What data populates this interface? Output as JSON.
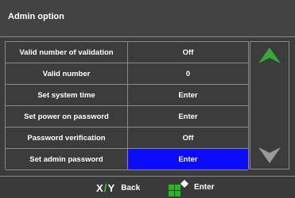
{
  "header": {
    "title": "Admin option"
  },
  "rows": [
    {
      "label": "Valid number of validation",
      "value": "Off"
    },
    {
      "label": "Valid number",
      "value": "0"
    },
    {
      "label": "Set system time",
      "value": "Enter"
    },
    {
      "label": "Set power on password",
      "value": "Enter"
    },
    {
      "label": "Password verification",
      "value": "Off"
    },
    {
      "label": "Set admin password",
      "value": "Enter",
      "selected": true
    }
  ],
  "side": {
    "up_icon": "up-arrow-icon",
    "down_icon": "down-arrow-icon"
  },
  "footer": {
    "x_key": "X",
    "y_key": "Y",
    "back_label": "Back",
    "enter_icon": "enter-icon",
    "enter_label": "Enter"
  },
  "colors": {
    "selection": "#0b0bff",
    "up_arrow": "#33aa33",
    "down_arrow": "#9a9a9a",
    "footer_green": "#33cc33"
  }
}
